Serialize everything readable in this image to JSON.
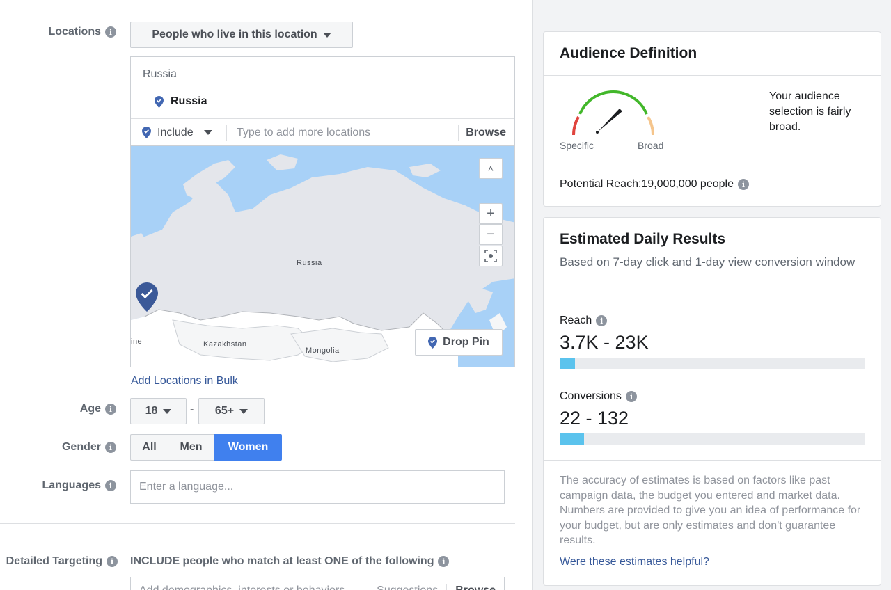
{
  "form": {
    "locations": {
      "label": "Locations",
      "dropdown_label": "People who live in this location",
      "section_heading": "Russia",
      "selected_location": "Russia",
      "include_label": "Include",
      "input_placeholder": "Type to add more locations",
      "browse_label": "Browse",
      "map_labels": {
        "russia": "Russia",
        "kazakhstan": "Kazakhstan",
        "mongolia": "Mongolia",
        "ukraine_partial": "ine"
      },
      "zoom_in": "+",
      "zoom_out": "−",
      "scroll_up": "˄",
      "drop_pin_label": "Drop Pin",
      "bulk_link": "Add Locations in Bulk"
    },
    "age": {
      "label": "Age",
      "min": "18",
      "separator": "-",
      "max": "65+"
    },
    "gender": {
      "label": "Gender",
      "options": [
        "All",
        "Men",
        "Women"
      ],
      "selected": "Women"
    },
    "languages": {
      "label": "Languages",
      "placeholder": "Enter a language..."
    },
    "detailed_targeting": {
      "label": "Detailed Targeting",
      "include_text": "INCLUDE people who match at least ONE of the following",
      "input_placeholder": "Add demographics, interests or behaviors",
      "suggestions_label": "Suggestions",
      "browse_label": "Browse"
    }
  },
  "sidebar": {
    "audience": {
      "title": "Audience Definition",
      "gauge_left": "Specific",
      "gauge_right": "Broad",
      "gauge_level": "fairly broad",
      "description": "Your audience selection is fairly broad.",
      "potential_reach": "Potential Reach:19,000,000 people"
    },
    "estimated": {
      "title": "Estimated Daily Results",
      "subtitle": "Based on 7-day click and 1-day view conversion window",
      "reach_label": "Reach",
      "reach_value": "3.7K - 23K",
      "reach_fill_fraction": 0.05,
      "conversions_label": "Conversions",
      "conversions_value": "22 - 132",
      "conversions_fill_fraction": 0.08,
      "disclaimer": "The accuracy of estimates is based on factors like past campaign data, the budget you entered and market data. Numbers are provided to give you an idea of performance for your budget, but are only estimates and don't guarantee results.",
      "feedback_link": "Were these estimates helpful?"
    }
  },
  "colors": {
    "accent": "#4080ee",
    "link": "#365899",
    "bar_fill": "#5bc3ed",
    "gauge_green": "#42b72a",
    "gauge_red": "#e0443e",
    "gauge_orange": "#f5c58c"
  }
}
